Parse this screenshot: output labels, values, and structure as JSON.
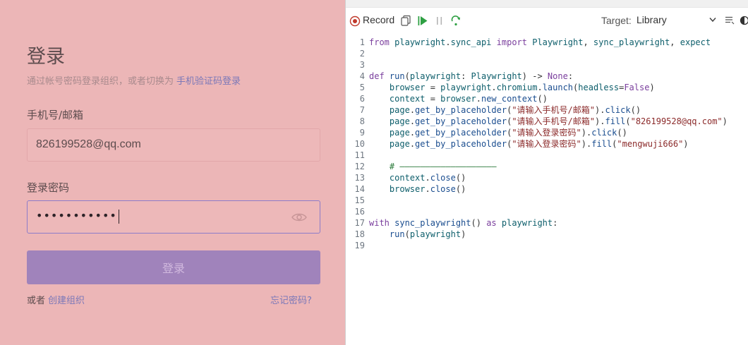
{
  "login": {
    "title": "登录",
    "subtitle": "通过帐号密码登录组织，或者切换为",
    "switch_link": "手机验证码登录",
    "account_label": "手机号/邮箱",
    "account_value": "826199528@qq.com",
    "password_label": "登录密码",
    "password_dots": "•••••••••••",
    "login_button": "登录",
    "footer_or": "或者",
    "create_org_link": "创建组织",
    "forgot_password_link": "忘记密码?"
  },
  "inspector": {
    "record_label": "Record",
    "target_label": "Target:",
    "target_value": "Library",
    "code_lines": [
      {
        "n": "1",
        "tokens": [
          {
            "t": "from ",
            "c": "kw"
          },
          {
            "t": "playwright",
            "c": "id"
          },
          {
            "t": ".",
            "c": "p"
          },
          {
            "t": "sync_api ",
            "c": "id"
          },
          {
            "t": "import ",
            "c": "kw"
          },
          {
            "t": "Playwright",
            "c": "id"
          },
          {
            "t": ", ",
            "c": "p"
          },
          {
            "t": "sync_playwright",
            "c": "id"
          },
          {
            "t": ", ",
            "c": "p"
          },
          {
            "t": "expect",
            "c": "id"
          }
        ]
      },
      {
        "n": "2",
        "tokens": []
      },
      {
        "n": "3",
        "tokens": []
      },
      {
        "n": "4",
        "tokens": [
          {
            "t": "def ",
            "c": "kw"
          },
          {
            "t": "run",
            "c": "fn"
          },
          {
            "t": "(",
            "c": "p"
          },
          {
            "t": "playwright",
            "c": "id"
          },
          {
            "t": ": ",
            "c": "p"
          },
          {
            "t": "Playwright",
            "c": "id"
          },
          {
            "t": ") -> ",
            "c": "p"
          },
          {
            "t": "None",
            "c": "kw"
          },
          {
            "t": ":",
            "c": "p"
          }
        ]
      },
      {
        "n": "5",
        "tokens": [
          {
            "t": "    ",
            "c": "p"
          },
          {
            "t": "browser",
            "c": "id"
          },
          {
            "t": " = ",
            "c": "p"
          },
          {
            "t": "playwright",
            "c": "id"
          },
          {
            "t": ".",
            "c": "p"
          },
          {
            "t": "chromium",
            "c": "id"
          },
          {
            "t": ".",
            "c": "p"
          },
          {
            "t": "launch",
            "c": "fn"
          },
          {
            "t": "(",
            "c": "p"
          },
          {
            "t": "headless",
            "c": "id"
          },
          {
            "t": "=",
            "c": "p"
          },
          {
            "t": "False",
            "c": "kw"
          },
          {
            "t": ")",
            "c": "p"
          }
        ]
      },
      {
        "n": "6",
        "tokens": [
          {
            "t": "    ",
            "c": "p"
          },
          {
            "t": "context",
            "c": "id"
          },
          {
            "t": " = ",
            "c": "p"
          },
          {
            "t": "browser",
            "c": "id"
          },
          {
            "t": ".",
            "c": "p"
          },
          {
            "t": "new_context",
            "c": "fn"
          },
          {
            "t": "()",
            "c": "p"
          }
        ]
      },
      {
        "n": "7",
        "tokens": [
          {
            "t": "    ",
            "c": "p"
          },
          {
            "t": "page",
            "c": "id"
          },
          {
            "t": ".",
            "c": "p"
          },
          {
            "t": "get_by_placeholder",
            "c": "fn"
          },
          {
            "t": "(",
            "c": "p"
          },
          {
            "t": "\"请输入手机号/邮箱\"",
            "c": "str"
          },
          {
            "t": ").",
            "c": "p"
          },
          {
            "t": "click",
            "c": "fn"
          },
          {
            "t": "()",
            "c": "p"
          }
        ]
      },
      {
        "n": "8",
        "tokens": [
          {
            "t": "    ",
            "c": "p"
          },
          {
            "t": "page",
            "c": "id"
          },
          {
            "t": ".",
            "c": "p"
          },
          {
            "t": "get_by_placeholder",
            "c": "fn"
          },
          {
            "t": "(",
            "c": "p"
          },
          {
            "t": "\"请输入手机号/邮箱\"",
            "c": "str"
          },
          {
            "t": ").",
            "c": "p"
          },
          {
            "t": "fill",
            "c": "fn"
          },
          {
            "t": "(",
            "c": "p"
          },
          {
            "t": "\"826199528@qq.com\"",
            "c": "str"
          },
          {
            "t": ")",
            "c": "p"
          }
        ]
      },
      {
        "n": "9",
        "tokens": [
          {
            "t": "    ",
            "c": "p"
          },
          {
            "t": "page",
            "c": "id"
          },
          {
            "t": ".",
            "c": "p"
          },
          {
            "t": "get_by_placeholder",
            "c": "fn"
          },
          {
            "t": "(",
            "c": "p"
          },
          {
            "t": "\"请输入登录密码\"",
            "c": "str"
          },
          {
            "t": ").",
            "c": "p"
          },
          {
            "t": "click",
            "c": "fn"
          },
          {
            "t": "()",
            "c": "p"
          }
        ]
      },
      {
        "n": "10",
        "tokens": [
          {
            "t": "    ",
            "c": "p"
          },
          {
            "t": "page",
            "c": "id"
          },
          {
            "t": ".",
            "c": "p"
          },
          {
            "t": "get_by_placeholder",
            "c": "fn"
          },
          {
            "t": "(",
            "c": "p"
          },
          {
            "t": "\"请输入登录密码\"",
            "c": "str"
          },
          {
            "t": ").",
            "c": "p"
          },
          {
            "t": "fill",
            "c": "fn"
          },
          {
            "t": "(",
            "c": "p"
          },
          {
            "t": "\"mengwuji666\"",
            "c": "str"
          },
          {
            "t": ")",
            "c": "p"
          }
        ]
      },
      {
        "n": "11",
        "tokens": []
      },
      {
        "n": "12",
        "tokens": [
          {
            "t": "    ",
            "c": "p"
          },
          {
            "t": "# ———————————————————",
            "c": "cm"
          }
        ]
      },
      {
        "n": "13",
        "tokens": [
          {
            "t": "    ",
            "c": "p"
          },
          {
            "t": "context",
            "c": "id"
          },
          {
            "t": ".",
            "c": "p"
          },
          {
            "t": "close",
            "c": "fn"
          },
          {
            "t": "()",
            "c": "p"
          }
        ]
      },
      {
        "n": "14",
        "tokens": [
          {
            "t": "    ",
            "c": "p"
          },
          {
            "t": "browser",
            "c": "id"
          },
          {
            "t": ".",
            "c": "p"
          },
          {
            "t": "close",
            "c": "fn"
          },
          {
            "t": "()",
            "c": "p"
          }
        ]
      },
      {
        "n": "15",
        "tokens": []
      },
      {
        "n": "16",
        "tokens": []
      },
      {
        "n": "17",
        "tokens": [
          {
            "t": "with ",
            "c": "kw"
          },
          {
            "t": "sync_playwright",
            "c": "fn"
          },
          {
            "t": "() ",
            "c": "p"
          },
          {
            "t": "as ",
            "c": "kw"
          },
          {
            "t": "playwright",
            "c": "id"
          },
          {
            "t": ":",
            "c": "p"
          }
        ]
      },
      {
        "n": "18",
        "tokens": [
          {
            "t": "    ",
            "c": "p"
          },
          {
            "t": "run",
            "c": "fn"
          },
          {
            "t": "(",
            "c": "p"
          },
          {
            "t": "playwright",
            "c": "id"
          },
          {
            "t": ")",
            "c": "p"
          }
        ]
      },
      {
        "n": "19",
        "tokens": []
      }
    ]
  },
  "colors": {
    "overlay_pink": "#ecb6b7",
    "accent_purple": "#a083bb",
    "link_purple": "#7b78b8",
    "record_red": "#c0392b",
    "play_green": "#2ea043"
  }
}
